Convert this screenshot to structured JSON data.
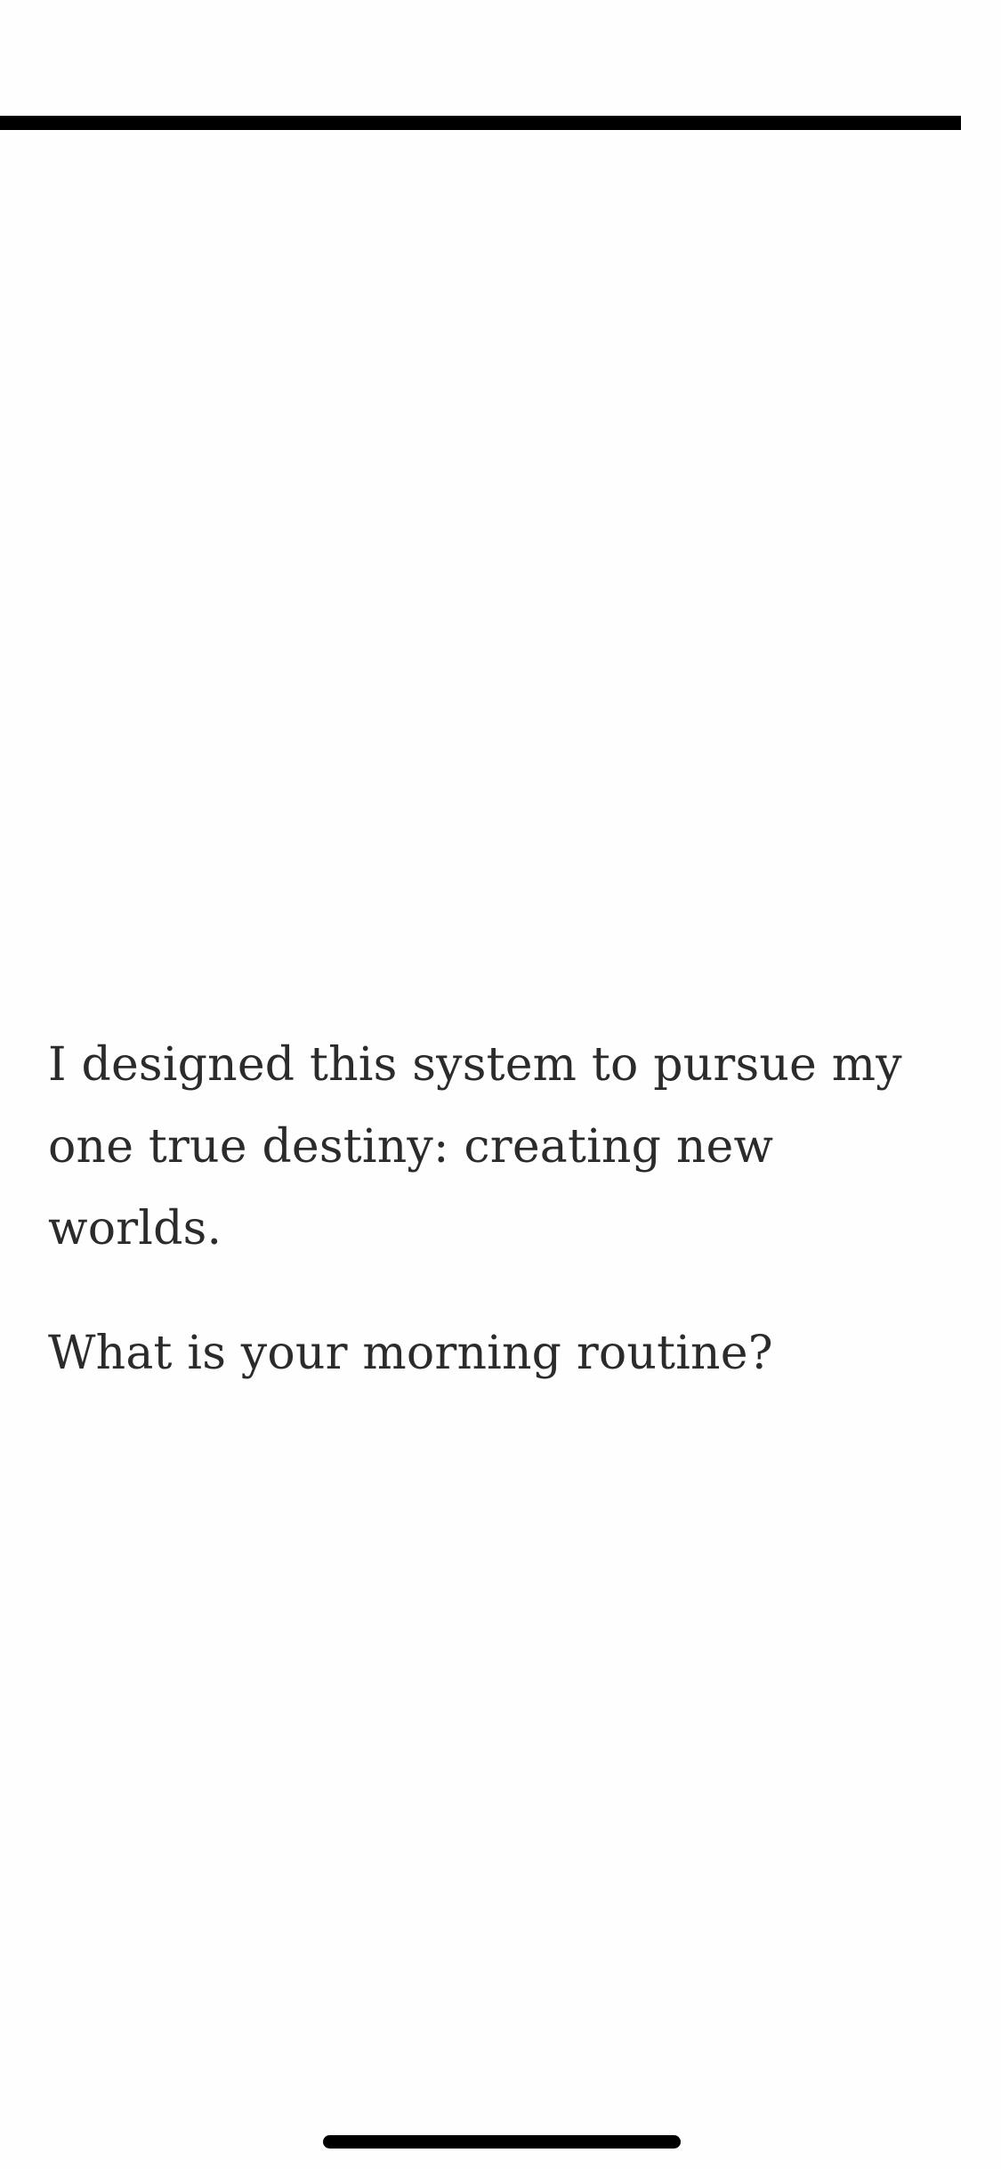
{
  "progress": {
    "fraction": 0.96,
    "color": "#000000"
  },
  "article": {
    "paragraphs": [
      "I designed this system to pursue my one true destiny: creating new worlds.",
      "What is your morning routine?"
    ]
  },
  "colors": {
    "background": "#fefefe",
    "text": "#2b2b2b"
  }
}
